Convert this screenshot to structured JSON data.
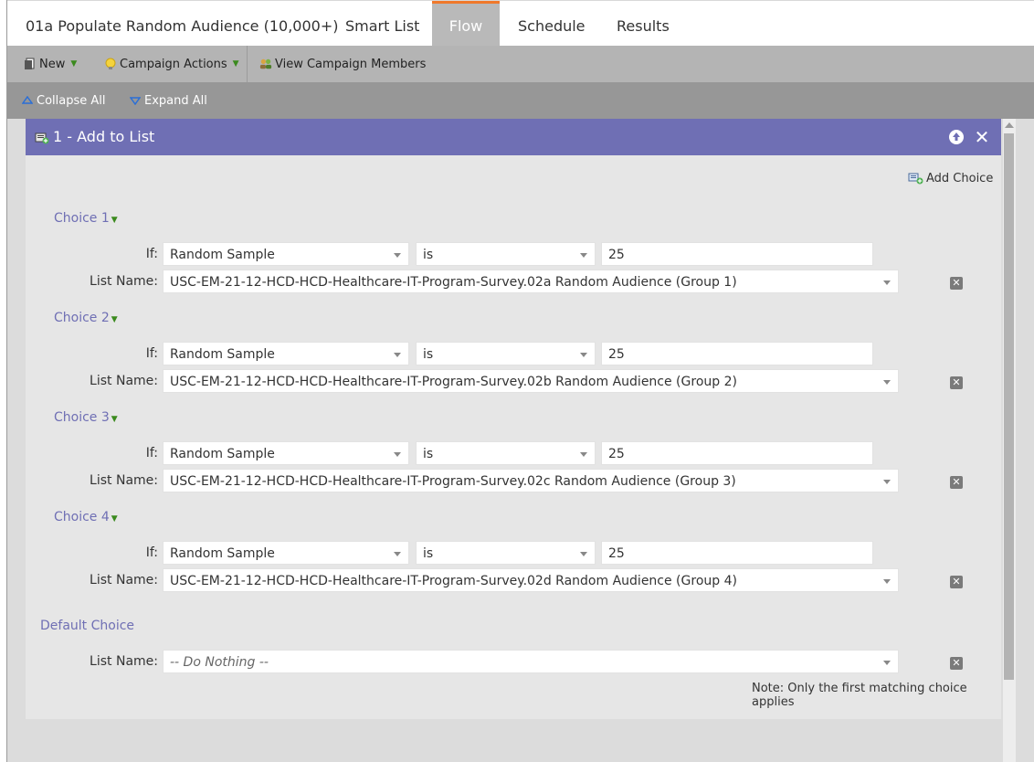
{
  "tabs": {
    "title": "01a Populate Random Audience (10,000+)",
    "smart_list": "Smart List",
    "flow": "Flow",
    "schedule": "Schedule",
    "results": "Results"
  },
  "toolbar": {
    "new_label": "New",
    "campaign_actions_label": "Campaign Actions",
    "view_members_label": "View Campaign Members"
  },
  "tree": {
    "collapse_label": "Collapse All",
    "expand_label": "Expand All"
  },
  "step": {
    "title": "1 - Add to List",
    "add_choice_label": "Add Choice",
    "if_label": "If:",
    "list_name_label": "List Name:",
    "choices": [
      {
        "label": "Choice 1",
        "field": "Random Sample",
        "operator": "is",
        "value": "25",
        "list": "USC-EM-21-12-HCD-HCD-Healthcare-IT-Program-Survey.02a Random Audience (Group 1)"
      },
      {
        "label": "Choice 2",
        "field": "Random Sample",
        "operator": "is",
        "value": "25",
        "list": "USC-EM-21-12-HCD-HCD-Healthcare-IT-Program-Survey.02b Random Audience (Group 2)"
      },
      {
        "label": "Choice 3",
        "field": "Random Sample",
        "operator": "is",
        "value": "25",
        "list": "USC-EM-21-12-HCD-HCD-Healthcare-IT-Program-Survey.02c Random Audience (Group 3)"
      },
      {
        "label": "Choice 4",
        "field": "Random Sample",
        "operator": "is",
        "value": "25",
        "list": "USC-EM-21-12-HCD-HCD-Healthcare-IT-Program-Survey.02d Random Audience (Group 4)"
      }
    ],
    "default_label": "Default Choice",
    "default_list": "-- Do Nothing --",
    "note": "Note: Only the first matching choice applies"
  },
  "colors": {
    "header_purple": "#6f6fb4",
    "active_tab_accent": "#f0792b",
    "caret_green": "#3b8a1e"
  }
}
